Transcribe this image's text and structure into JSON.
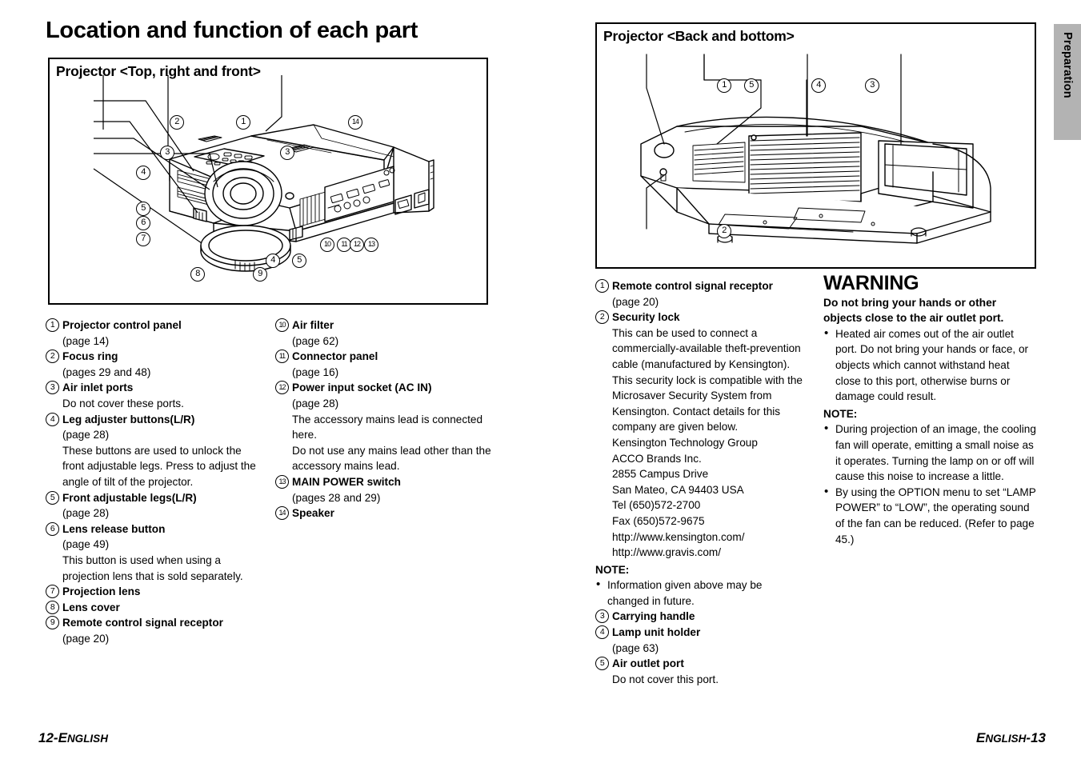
{
  "document": {
    "title": "Location and function of each part",
    "side_tab": "Preparation",
    "footer_left_page": "12",
    "footer_left_lang": "English",
    "footer_right_lang": "English",
    "footer_right_page": "13"
  },
  "figures": {
    "left": {
      "caption": "Projector <Top, right and front>",
      "callouts": [
        "1",
        "2",
        "3",
        "4",
        "5",
        "6",
        "7",
        "8",
        "9",
        "10",
        "11",
        "12",
        "13",
        "14"
      ]
    },
    "right": {
      "caption": "Projector <Back and bottom>",
      "callouts": [
        "1",
        "2",
        "3",
        "4",
        "5"
      ]
    }
  },
  "left_page": {
    "column1": [
      {
        "num": "1",
        "name": "Projector control panel",
        "desc": [
          "(page 14)"
        ]
      },
      {
        "num": "2",
        "name": "Focus ring",
        "desc": [
          "(pages 29 and 48)"
        ]
      },
      {
        "num": "3",
        "name": "Air inlet ports",
        "desc": [
          "Do not cover these ports."
        ]
      },
      {
        "num": "4",
        "name": "Leg adjuster buttons(L/R)",
        "desc": [
          "(page 28)",
          "These buttons are used to unlock the front adjustable legs. Press to adjust the angle of tilt of the projector."
        ]
      },
      {
        "num": "5",
        "name": "Front adjustable legs(L/R)",
        "desc": [
          "(page 28)"
        ]
      },
      {
        "num": "6",
        "name": "Lens release button",
        "desc": [
          "(page 49)",
          "This button is used when using a projection lens that is sold separately."
        ]
      },
      {
        "num": "7",
        "name": "Projection lens",
        "desc": []
      },
      {
        "num": "8",
        "name": "Lens cover",
        "desc": []
      },
      {
        "num": "9",
        "name": "Remote control signal receptor",
        "desc": [
          "(page 20)"
        ]
      }
    ],
    "column2": [
      {
        "num": "10",
        "name": "Air filter",
        "desc": [
          "(page 62)"
        ]
      },
      {
        "num": "11",
        "name": "Connector panel",
        "desc": [
          "(page 16)"
        ]
      },
      {
        "num": "12",
        "name": "Power input socket (AC IN)",
        "desc": [
          "(page 28)",
          "The accessory mains lead is connected here.",
          "Do not use any mains lead other than the accessory mains lead."
        ]
      },
      {
        "num": "13",
        "name": "MAIN POWER switch",
        "desc": [
          "(pages 28 and 29)"
        ]
      },
      {
        "num": "14",
        "name": "Speaker",
        "desc": []
      }
    ]
  },
  "right_page": {
    "column1_a": [
      {
        "num": "1",
        "name": "Remote control signal receptor",
        "desc": [
          "(page 20)"
        ]
      },
      {
        "num": "2",
        "name": "Security lock",
        "desc": [
          "This can be used to connect a commercially-available theft-prevention cable (manufactured by Kensington). This security lock is compatible with the Microsaver Security System from Kensington. Contact details for this company are given below.",
          "Kensington Technology Group",
          "ACCO Brands Inc.",
          "2855 Campus Drive",
          "San Mateo, CA 94403 USA",
          "Tel (650)572-2700",
          "Fax (650)572-9675",
          "http://www.kensington.com/",
          "http://www.gravis.com/"
        ]
      }
    ],
    "note1_head": "NOTE:",
    "note1_bullets": [
      "Information given above may be changed in future."
    ],
    "column1_b": [
      {
        "num": "3",
        "name": "Carrying handle",
        "desc": []
      },
      {
        "num": "4",
        "name": "Lamp unit holder",
        "desc": [
          "(page 63)"
        ]
      },
      {
        "num": "5",
        "name": "Air outlet port",
        "desc": [
          "Do not cover this port."
        ]
      }
    ],
    "warning_title": "WARNING",
    "warning_lead": "Do not bring your hands or other objects close to the air outlet port.",
    "warning_bullets": [
      "Heated air comes out of the air outlet port. Do not bring your hands or face, or objects which cannot withstand heat close to this port, otherwise burns or damage could result."
    ],
    "note2_head": "NOTE:",
    "note2_bullets": [
      "During projection of an image, the cooling fan will operate, emitting a small noise as it operates. Turning the lamp on or off will cause this noise to increase a little.",
      "By using the OPTION menu to set “LAMP POWER” to “LOW”, the operating sound of the fan can be reduced. (Refer to page 45.)"
    ]
  }
}
